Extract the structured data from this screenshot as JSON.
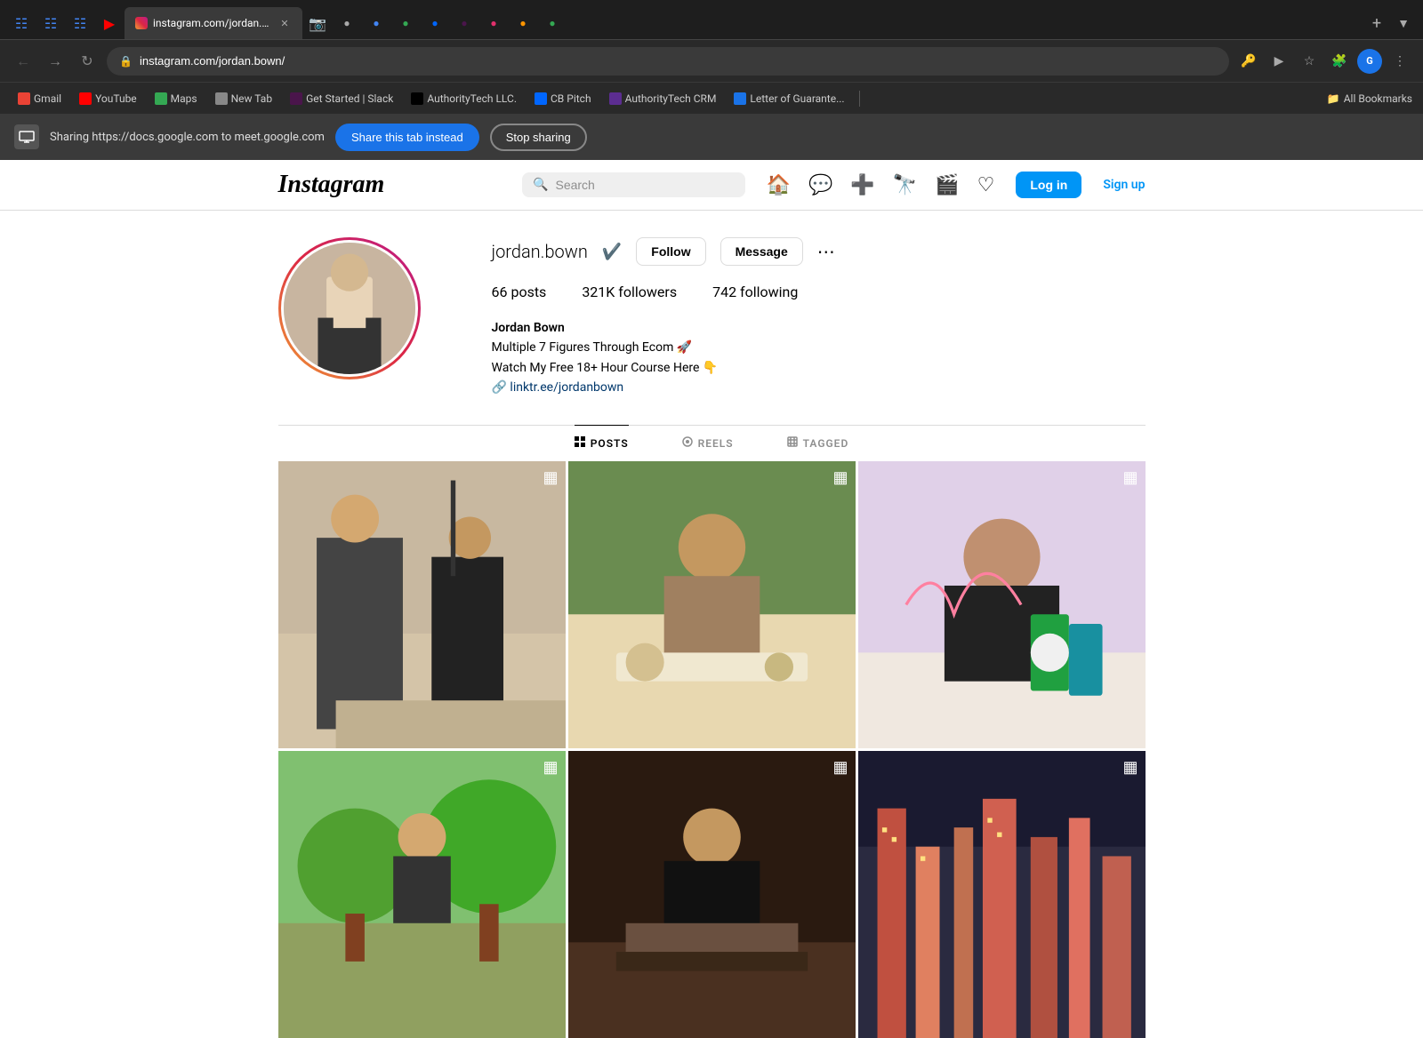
{
  "browser": {
    "tabs": [
      {
        "id": "tab-docs",
        "favicon_color": "#4285f4",
        "title": "Google Docs",
        "active": false
      },
      {
        "id": "tab-docs2",
        "favicon_color": "#4285f4",
        "title": "Google Docs",
        "active": false
      },
      {
        "id": "tab-docs3",
        "favicon_color": "#4285f4",
        "title": "Google Docs",
        "active": false
      },
      {
        "id": "tab-youtube",
        "favicon_color": "#ff0000",
        "title": "YouTube",
        "active": false
      },
      {
        "id": "tab-instagram",
        "favicon_color": "#e1306c",
        "title": "instagram.com/jordan.bown/",
        "active": true
      },
      {
        "id": "tab-instagram2",
        "favicon_color": "#c13584",
        "title": "Instagram",
        "active": false
      }
    ],
    "address": "instagram.com/jordan.bown/",
    "bookmarks": [
      {
        "label": "Gmail",
        "favicon_color": "#ea4335"
      },
      {
        "label": "YouTube",
        "favicon_color": "#ff0000"
      },
      {
        "label": "Maps",
        "favicon_color": "#34a853"
      },
      {
        "label": "New Tab",
        "favicon_color": "#888"
      },
      {
        "label": "Get Started | Slack",
        "favicon_color": "#4a154b"
      },
      {
        "label": "AuthorityTech LLC.",
        "favicon_color": "#000"
      },
      {
        "label": "CB Pitch",
        "favicon_color": "#0066ff"
      },
      {
        "label": "AuthorityTech CRM",
        "favicon_color": "#5c2d91"
      },
      {
        "label": "Letter of Guarante...",
        "favicon_color": "#1a73e8"
      }
    ],
    "bookmarks_all_label": "All Bookmarks"
  },
  "sharing_bar": {
    "sharing_text": "Sharing https://docs.google.com to meet.google.com",
    "share_tab_btn": "Share this tab instead",
    "stop_sharing_btn": "Stop sharing"
  },
  "instagram": {
    "logo": "Instagram",
    "search_placeholder": "Search",
    "login_label": "Log in",
    "signup_label": "Sign up",
    "profile": {
      "username": "jordan.bown",
      "verified": true,
      "follow_label": "Follow",
      "message_label": "Message",
      "posts_count": "66 posts",
      "followers_count": "321K followers",
      "following_count": "742 following",
      "display_name": "Jordan Bown",
      "bio_line1": "Multiple 7 Figures Through Ecom 🚀",
      "bio_line2": "Watch My Free 18+ Hour Course Here 👇",
      "bio_link": "linktr.ee/jordanbown"
    },
    "tabs": [
      {
        "label": "POSTS",
        "active": true,
        "icon": "grid-icon"
      },
      {
        "label": "REELS",
        "active": false,
        "icon": "reels-icon"
      },
      {
        "label": "TAGGED",
        "active": false,
        "icon": "tagged-icon"
      }
    ],
    "posts": [
      {
        "id": "post-1",
        "multi": true,
        "img_class": "img-1"
      },
      {
        "id": "post-2",
        "multi": true,
        "img_class": "img-2"
      },
      {
        "id": "post-3",
        "multi": true,
        "img_class": "img-3"
      },
      {
        "id": "post-4",
        "multi": true,
        "img_class": "img-4"
      },
      {
        "id": "post-5",
        "multi": true,
        "img_class": "img-5"
      },
      {
        "id": "post-6",
        "multi": true,
        "img_class": "img-6"
      }
    ]
  }
}
